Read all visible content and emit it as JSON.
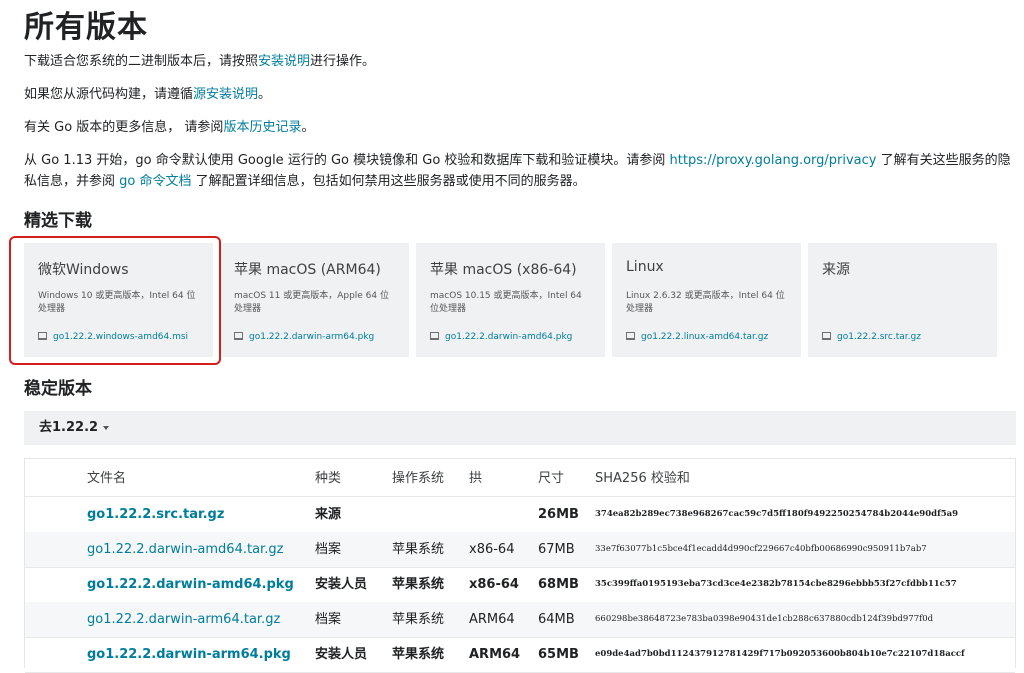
{
  "page_title": "所有版本",
  "intro": {
    "p1_pre": "下载适合您系统的二进制版本后，请按照",
    "p1_link": "安装说明",
    "p1_post": "进行操作。",
    "p2_pre": "如果您从源代码构建，请遵循",
    "p2_link": "源安装说明",
    "p2_post": "。",
    "p3_pre": "有关 Go 版本的更多信息，  请参阅",
    "p3_link": "版本历史记录",
    "p3_post": "。",
    "p4_a": "从 Go 1.13 开始，go 命令默认使用 Google 运行的 Go 模块镜像和 Go 校验和数据库下载和验证模块。请参阅 ",
    "p4_link1": "https://proxy.golang.org/privacy",
    "p4_b": " 了解有关这些服务的隐私信息，并参阅 ",
    "p4_link2": "go 命令文档",
    "p4_c": " 了解配置详细信息，包括如何禁用这些服务器或使用不同的服务器。"
  },
  "featured": {
    "heading": "精选下载",
    "cards": [
      {
        "title": "微软Windows",
        "desc": "Windows 10 或更高版本，Intel 64 位处理器",
        "file": "go1.22.2.windows-amd64.msi"
      },
      {
        "title": "苹果 macOS (ARM64)",
        "desc": "macOS 11 或更高版本，Apple 64 位处理器",
        "file": "go1.22.2.darwin-arm64.pkg"
      },
      {
        "title": "苹果 macOS (x86-64)",
        "desc": "macOS 10.15 或更高版本，Intel 64 位处理器",
        "file": "go1.22.2.darwin-amd64.pkg"
      },
      {
        "title": "Linux",
        "desc": "Linux 2.6.32 或更高版本，Intel 64 位处理器",
        "file": "go1.22.2.linux-amd64.tar.gz"
      },
      {
        "title": "来源",
        "desc": "",
        "file": "go1.22.2.src.tar.gz"
      }
    ]
  },
  "stable": {
    "heading": "稳定版本",
    "version_toggle": "去1.22.2",
    "columns": [
      "文件名",
      "种类",
      "操作系统",
      "拱",
      "尺寸",
      "SHA256 校验和"
    ],
    "rows": [
      {
        "file": "go1.22.2.src.tar.gz",
        "kind": "来源",
        "os": "",
        "arch": "",
        "size": "26MB",
        "sha": "374ea82b289ec738e968267cac59c7d5ff180f9492250254784b2044e90df5a9",
        "bold": true
      },
      {
        "file": "go1.22.2.darwin-amd64.tar.gz",
        "kind": "档案",
        "os": "苹果系统",
        "arch": "x86-64",
        "size": "67MB",
        "sha": "33e7f63077b1c5bce4f1ecadd4d990cf229667c40bfb00686990c950911b7ab7",
        "bold": false
      },
      {
        "file": "go1.22.2.darwin-amd64.pkg",
        "kind": "安装人员",
        "os": "苹果系统",
        "arch": "x86-64",
        "size": "68MB",
        "sha": "35c399ffa0195193eba73cd3ce4e2382b78154cbe8296ebbb53f27cfdbb11c57",
        "bold": true
      },
      {
        "file": "go1.22.2.darwin-arm64.tar.gz",
        "kind": "档案",
        "os": "苹果系统",
        "arch": "ARM64",
        "size": "64MB",
        "sha": "660298be38648723e783ba0398e90431de1cb288c637880cdb124f39bd977f0d",
        "bold": false
      },
      {
        "file": "go1.22.2.darwin-arm64.pkg",
        "kind": "安装人员",
        "os": "苹果系统",
        "arch": "ARM64",
        "size": "65MB",
        "sha": "e09de4ad7b0bd112437912781429f717b092053600b804b10e7c22107d18accf",
        "bold": true
      }
    ]
  }
}
